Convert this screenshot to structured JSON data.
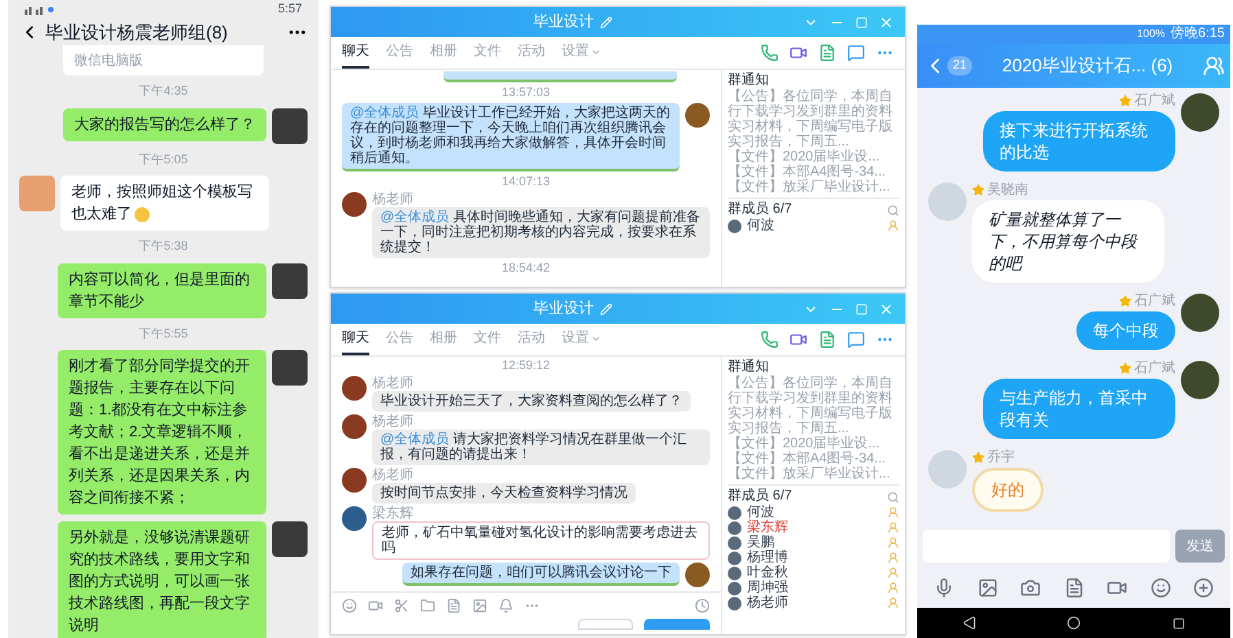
{
  "wechat": {
    "status_time": "5:57",
    "title": "毕业设计杨震老师组(8)",
    "card_source": "微信电脑版",
    "messages": [
      {
        "kind": "time",
        "text": "下午4:35"
      },
      {
        "kind": "sent",
        "text": "大家的报告写的怎么样了？",
        "emoji": false
      },
      {
        "kind": "time",
        "text": "下午5:05"
      },
      {
        "kind": "received",
        "text": "老师，按照师姐这个模板写也太难了",
        "emoji": true
      },
      {
        "kind": "time",
        "text": "下午5:38"
      },
      {
        "kind": "sent",
        "text": "内容可以简化，但是里面的章节不能少",
        "emoji": false
      },
      {
        "kind": "time",
        "text": "下午5:55"
      },
      {
        "kind": "sent",
        "text": "刚才看了部分同学提交的开题报告，主要存在以下问题：1.都没有在文中标注参考文献；2.文章逻辑不顺，看不出是递进关系，还是并列关系，还是因果关系，内容之间衔接不紧；",
        "emoji": false
      },
      {
        "kind": "sent",
        "text": "另外就是，没够说清课题研究的技术路线，要用文字和图的方式说明，可以画一张技术路线图，再配一段文字说明",
        "emoji": false
      }
    ]
  },
  "qq_windows": [
    {
      "title": "毕业设计",
      "composer": false,
      "tabs": [
        {
          "label": "聊天",
          "selected": true
        },
        {
          "label": "公告",
          "selected": false
        },
        {
          "label": "相册",
          "selected": false
        },
        {
          "label": "文件",
          "selected": false
        },
        {
          "label": "活动",
          "selected": false
        },
        {
          "label": "设置",
          "selected": false
        }
      ],
      "messages": [
        {
          "kind": "cut"
        },
        {
          "kind": "time",
          "text": "13:57:03"
        },
        {
          "kind": "sent",
          "mention": "@全体成员",
          "text": "毕业设计工作已经开始，大家把这两天的存在的问题整理一下，今天晚上咱们再次组织腾讯会议，到时杨老师和我再给大家做解答，具体开会时间稍后通知。"
        },
        {
          "kind": "time",
          "text": "14:07:13"
        },
        {
          "kind": "received",
          "name": "杨老师",
          "mention": "@全体成员",
          "text": "具体时间晚些通知，大家有问题提前准备一下，同时注意把初期考核的内容完成，按要求在系统提交！"
        },
        {
          "kind": "time",
          "text": "18:54:42"
        }
      ],
      "notice": {
        "title": "群通知",
        "items": [
          "【公告】各位同学，本周自行下载学习发到群里的资料实习材料，下周编写电子版实习报告，下周五...",
          "【文件】2020届毕业设...",
          "【文件】本部A4图号-34...",
          "【文件】放采厂毕业设计..."
        ]
      },
      "members_title": "群成员 6/7",
      "members": [
        {
          "name": "何波",
          "highlighted": false
        }
      ]
    },
    {
      "title": "毕业设计",
      "composer": true,
      "tabs": [
        {
          "label": "聊天",
          "selected": true
        },
        {
          "label": "公告",
          "selected": false
        },
        {
          "label": "相册",
          "selected": false
        },
        {
          "label": "文件",
          "selected": false
        },
        {
          "label": "活动",
          "selected": false
        },
        {
          "label": "设置",
          "selected": false
        }
      ],
      "messages": [
        {
          "kind": "time",
          "text": "12:59:12"
        },
        {
          "kind": "received",
          "name": "杨老师",
          "text": "毕业设计开始三天了，大家资料查阅的怎么样了？"
        },
        {
          "kind": "received",
          "name": "杨老师",
          "mention": "@全体成员",
          "text": "请大家把资料学习情况在群里做一个汇报，有问题的请提出来！"
        },
        {
          "kind": "received",
          "name": "杨老师",
          "text": "按时间节点安排，今天检查资料学习情况"
        },
        {
          "kind": "outlined",
          "name": "梁东辉",
          "text": "老师，矿石中氧量碰对氢化设计的影响需要考虑进去吗"
        },
        {
          "kind": "sent",
          "text": "如果存在问题，咱们可以腾讯会议讨论一下"
        }
      ],
      "notice": {
        "title": "群通知",
        "items": [
          "【公告】各位同学，本周自行下载学习发到群里的资料实习材料，下周编写电子版实习报告，下周五...",
          "【文件】2020届毕业设...",
          "【文件】本部A4图号-34...",
          "【文件】放采厂毕业设计..."
        ]
      },
      "members_title": "群成员 6/7",
      "members": [
        {
          "name": "何波",
          "highlighted": false
        },
        {
          "name": "梁东辉",
          "highlighted": true
        },
        {
          "name": "吴鹏",
          "highlighted": false
        },
        {
          "name": "杨理博",
          "highlighted": false
        },
        {
          "name": "叶金秋",
          "highlighted": false
        },
        {
          "name": "周坤强",
          "highlighted": false
        },
        {
          "name": "杨老师",
          "highlighted": false
        }
      ]
    }
  ],
  "qq_mobile": {
    "battery": "100%",
    "status_time": "傍晚6:15",
    "back_count": "21",
    "title": "2020毕业设计石... (6)",
    "send_label": "发送",
    "messages": [
      {
        "kind": "sent",
        "name": "石广斌",
        "text": "接下来进行开拓系统的比选"
      },
      {
        "kind": "handwritten",
        "name": "吴晓南",
        "text": "矿量就整体算了一下，不用算每个中段的吧"
      },
      {
        "kind": "sent",
        "name": "石广斌",
        "text": "每个中段"
      },
      {
        "kind": "sent",
        "name": "石广斌",
        "text": "与生产能力，首采中段有关"
      },
      {
        "kind": "sticker",
        "name": "乔宇",
        "text": "好的"
      }
    ]
  }
}
